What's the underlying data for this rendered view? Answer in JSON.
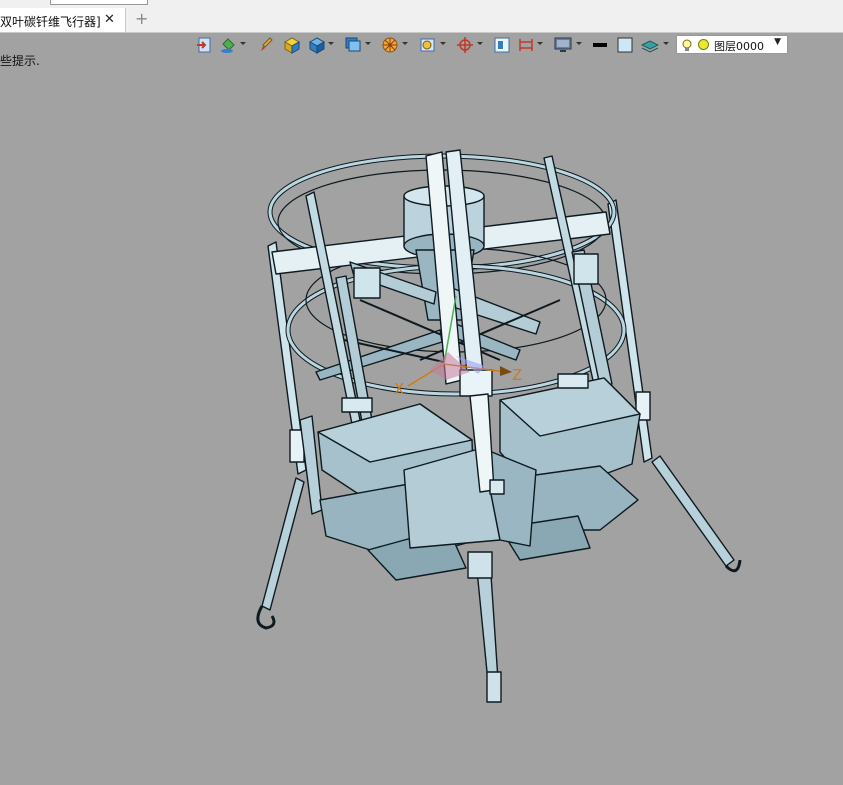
{
  "tab": {
    "title": "双叶碳钎维飞行器]",
    "close": "✕",
    "add": "+"
  },
  "hint": "些提示.",
  "layer": {
    "name": "图层0000"
  },
  "axes": {
    "x": "X",
    "z": "Z"
  },
  "colors": {
    "viewport_bg": "#a2a2a2",
    "model_fill": "#a8c4d0",
    "model_light": "#d8ecf2",
    "model_edge": "#0e1a20"
  },
  "icons": [
    "exit-icon",
    "paint-bucket-icon",
    "brush-icon",
    "cube-yellow-icon",
    "cube-blue-icon",
    "cube-face-icon",
    "orange-wheel-icon",
    "view-orient-icon",
    "crosshair-icon",
    "frame-icon",
    "dimension-icon",
    "monitor-icon",
    "line-color-icon",
    "fill-color-icon",
    "layer-stack-icon",
    "bulb-icon"
  ]
}
